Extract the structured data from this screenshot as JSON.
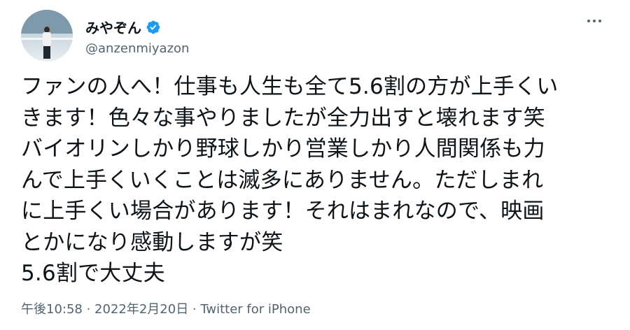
{
  "tweet": {
    "display_name": "みやぞん",
    "handle": "@anzenmiyazon",
    "body": "ファンの人へ！仕事も人生も全て5.6割の方が上手くい\nきます！色々な事やりましたが全力出すと壊れます笑\nバイオリンしかり野球しかり営業しかり人間関係も力\nんで上手くいくことは滅多にありません。ただしまれ\nに上手くい場合があります！それはまれなので、映画\nとかになり感動しますが笑\n5.6割で大丈夫",
    "timestamp": "午後10:58 · 2022年2月20日 · Twitter for iPhone"
  },
  "icons": {
    "verified": "verified-badge-icon",
    "more": "more-options-icon"
  },
  "colors": {
    "verified_blue": "#1d9bf0",
    "text_primary": "#0f1419",
    "text_secondary": "#536471"
  }
}
